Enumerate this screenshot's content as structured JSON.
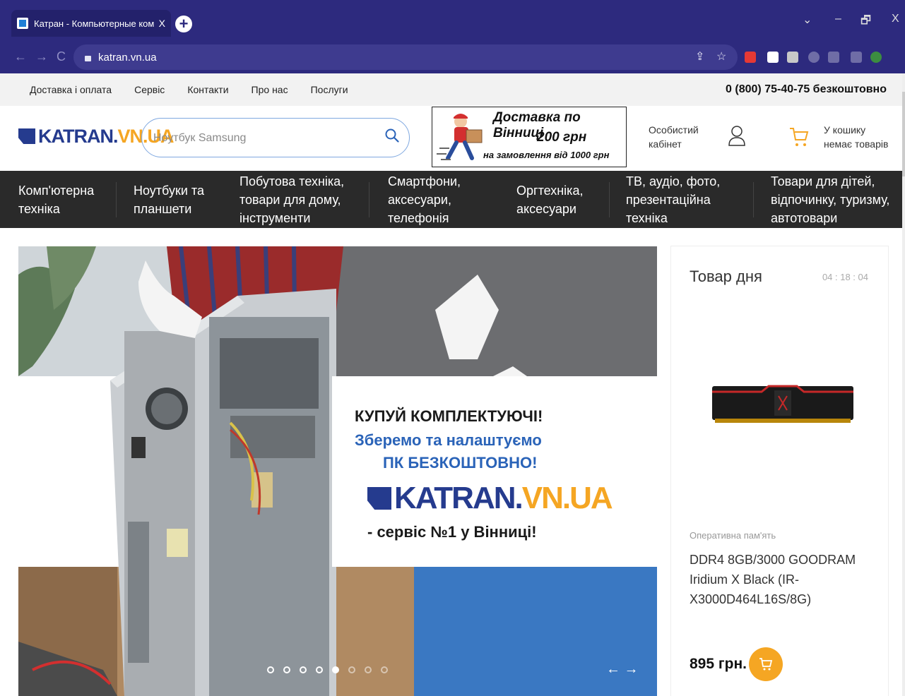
{
  "browser": {
    "tab_title": "Катран - Компьютерные компл",
    "tab_close": "X",
    "new_tab": "+",
    "url": "katran.vn.ua",
    "controls": {
      "dropdown": "⌄",
      "minimize": "–",
      "restore": "🗗",
      "close": "X"
    },
    "nav": {
      "back": "←",
      "forward": "→",
      "reload": "C"
    },
    "omni_icons": {
      "share": "⇪",
      "bookmark": "☆"
    },
    "extension_colors": [
      "#e53935",
      "#ffffff",
      "#c8c8c8",
      "#6f6da6",
      "#6f6da6",
      "#6f6da6",
      "#3c8d40"
    ]
  },
  "topnav": {
    "links": [
      "Доставка і оплата",
      "Сервіс",
      "Контакти",
      "Про нас",
      "Послуги"
    ],
    "phone": "0 (800) 75-40-75 безкоштовно"
  },
  "header": {
    "logo_main": "KATRAN.",
    "logo_accent": "VN.UA",
    "search_placeholder": "Ноутбук Samsung",
    "promo_line1": "Доставка по Вінниці",
    "promo_line2": "200 грн",
    "promo_line3": "на замовлення від 1000 грн",
    "account_line1": "Особистий",
    "account_line2": "кабінет",
    "cart_line1": "У кошику",
    "cart_line2": "немає товарів"
  },
  "categories": [
    {
      "lines": [
        "Комп'ютерна",
        "техніка"
      ]
    },
    {
      "lines": [
        "Ноутбуки та",
        "планшети"
      ]
    },
    {
      "lines": [
        "Побутова техніка,",
        "товари для дому,",
        "інструменти"
      ]
    },
    {
      "lines": [
        "Смартфони,",
        "аксесуари,",
        "телефонія"
      ]
    },
    {
      "lines": [
        "Оргтехніка,",
        "аксесуари"
      ]
    },
    {
      "lines": [
        "ТВ, аудіо, фото,",
        "презентаційна",
        "техніка"
      ]
    },
    {
      "lines": [
        "Товари для дітей,",
        "відпочинку, туризму,",
        "автотовари"
      ]
    }
  ],
  "hero": {
    "line1": "КУПУЙ КОМПЛЕКТУЮЧІ!",
    "line2": "Зберемо та налаштуємо",
    "line3_prefix": "ПК ",
    "line3_bold": "БЕЗКОШТОВНО!",
    "logo_main": "KATRAN.",
    "logo_accent": "VN.UA",
    "line4": "- сервіс №1 у Вінниці!",
    "slides_total": 8,
    "active_slide": 5,
    "arrows": "← →"
  },
  "deal": {
    "title": "Товар дня",
    "timer": "04 : 18 : 04",
    "category": "Оперативна пам'ять",
    "name": "DDR4 8GB/3000 GOODRAM Iridium X Black (IR-X3000D464L16S/8G)",
    "price": "895 грн."
  },
  "colors": {
    "brand_blue": "#253b8e",
    "accent": "#f5a623",
    "chrome": "#2d2a7e",
    "catbar": "#2a2a2a"
  }
}
